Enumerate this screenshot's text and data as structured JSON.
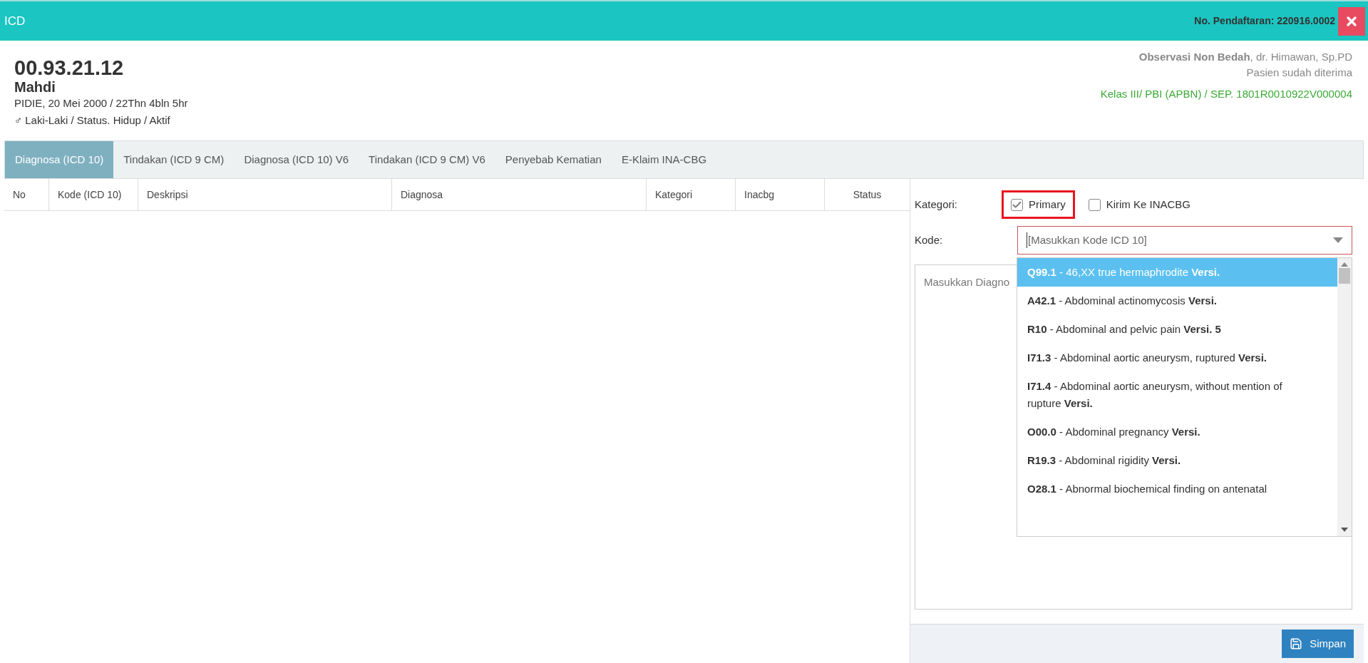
{
  "window": {
    "title": "ICD",
    "registration": "No. Pendaftaran: 220916.0002"
  },
  "patient": {
    "id": "00.93.21.12",
    "name": "Mahdi",
    "birth": "PIDIE, 20 Mei 2000 / 22Thn 4bln 5hr",
    "gender_symbol": "♂",
    "status": "Laki-Laki / Status. Hidup / Aktif",
    "unit": "**Observasi Non Bedah**, dr. Himawan, Sp.PD",
    "admission": "Pasien sudah diterima",
    "insurance": "Kelas III/ PBI (APBN) / SEP. 1801R0010922V000004"
  },
  "tabs": [
    {
      "label": "Diagnosa (ICD 10)",
      "selected": true
    },
    {
      "label": "Tindakan (ICD 9 CM)",
      "selected": false
    },
    {
      "label": "Diagnosa (ICD 10) V6",
      "selected": false
    },
    {
      "label": "Tindakan (ICD 9 CM) V6",
      "selected": false
    },
    {
      "label": "Penyebab Kematian",
      "selected": false
    },
    {
      "label": "E-Klaim INA-CBG",
      "selected": false
    }
  ],
  "table": {
    "columns": [
      "No",
      "Kode (ICD 10)",
      "Deskripsi",
      "Diagnosa",
      "Kategori",
      "Inacbg",
      "Status"
    ]
  },
  "form": {
    "kategori_label": "Kategori:",
    "checkboxes": [
      {
        "label": "Primary",
        "checked": true,
        "highlighted": true
      },
      {
        "label": "Kirim Ke INACBG",
        "checked": false,
        "highlighted": false
      }
    ],
    "kode_label": "Kode:",
    "kode": {
      "placeholder": "[Masukkan Kode ICD 10]"
    },
    "diagnosis": {
      "placeholder": "Masukkan Diagno"
    },
    "options": [
      {
        "text": "**Q99.1** - 46,XX true hermaphrodite **Versi.**",
        "selected": true
      },
      {
        "text": "**A42.1** - Abdominal actinomycosis **Versi.**",
        "selected": false
      },
      {
        "text": "**R10** - Abdominal and pelvic pain **Versi. 5**",
        "selected": false
      },
      {
        "text": "**I71.3** - Abdominal aortic aneurysm, ruptured **Versi.**",
        "selected": false
      },
      {
        "text": "**I71.4** - Abdominal aortic aneurysm, without mention of rupture **Versi.**",
        "selected": false
      },
      {
        "text": "**O00.0** - Abdominal pregnancy **Versi.**",
        "selected": false
      },
      {
        "text": "**R19.3** - Abdominal rigidity **Versi.**",
        "selected": false
      },
      {
        "text": "**O28.1** - Abnormal biochemical finding on antenatal",
        "selected": false
      }
    ],
    "save": "Simpan"
  }
}
